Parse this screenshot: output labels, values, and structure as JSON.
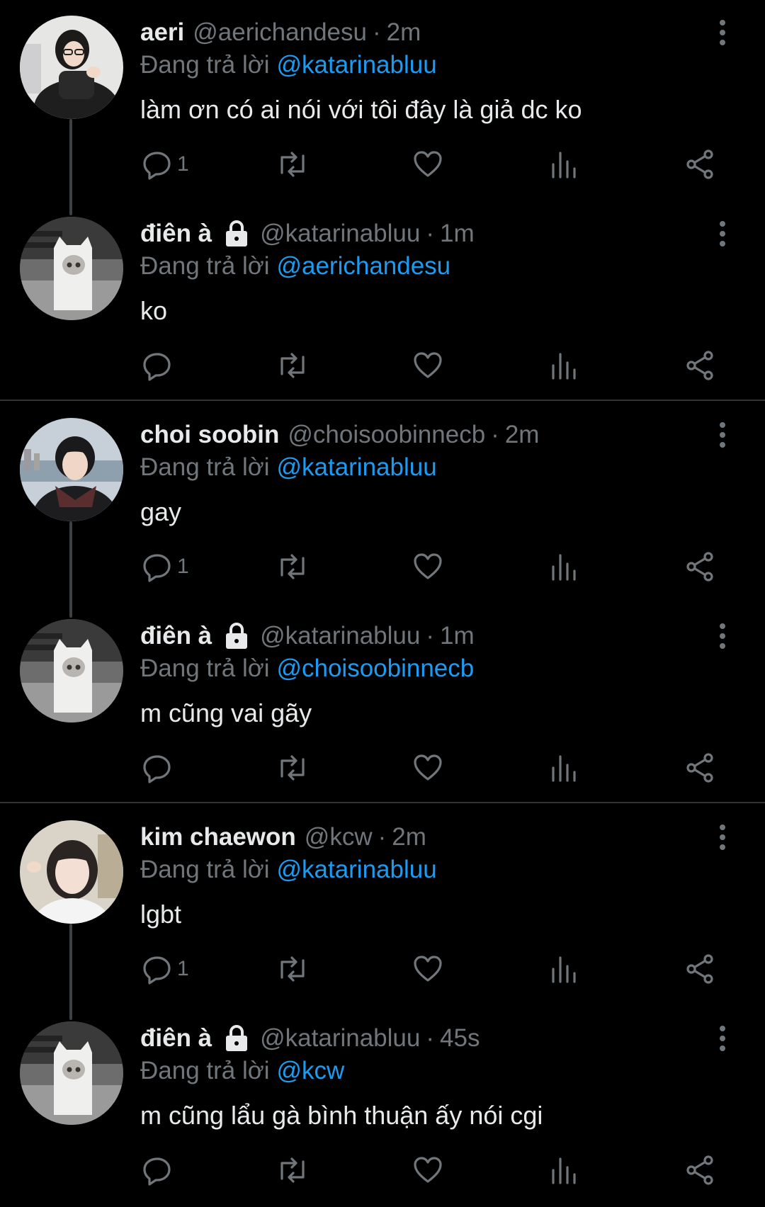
{
  "colors": {
    "background": "#000000",
    "primary_text": "#e7e9ea",
    "secondary_text": "#71767b",
    "mention_blue": "#1d9bf0",
    "divider": "#2f3336"
  },
  "threads": [
    {
      "tweets": [
        {
          "name": "aeri",
          "locked": false,
          "handle": "@aerichandesu",
          "separator": "·",
          "time": "2m",
          "reply_label": "Đang trả lời",
          "reply_to": "@katarinabluu",
          "text": "làm ơn có ai nói với tôi đây là giả dc ko",
          "reply_count": "1",
          "avatar": "aeri-avatar"
        },
        {
          "name": "điên à",
          "locked": true,
          "handle": "@katarinabluu",
          "separator": "·",
          "time": "1m",
          "reply_label": "Đang trả lời",
          "reply_to": "@aerichandesu",
          "text": "ko",
          "reply_count": "",
          "avatar": "ghost-figure-avatar"
        }
      ]
    },
    {
      "tweets": [
        {
          "name": "choi soobin",
          "locked": false,
          "handle": "@choisoobinnecb",
          "separator": "·",
          "time": "2m",
          "reply_label": "Đang trả lời",
          "reply_to": "@katarinabluu",
          "text": "gay",
          "reply_count": "1",
          "avatar": "soobin-avatar"
        },
        {
          "name": "điên à",
          "locked": true,
          "handle": "@katarinabluu",
          "separator": "·",
          "time": "1m",
          "reply_label": "Đang trả lời",
          "reply_to": "@choisoobinnecb",
          "text": "m cũng vai gãy",
          "reply_count": "",
          "avatar": "ghost-figure-avatar"
        }
      ]
    },
    {
      "tweets": [
        {
          "name": "kim chaewon",
          "locked": false,
          "handle": "@kcw",
          "separator": "·",
          "time": "2m",
          "reply_label": "Đang trả lời",
          "reply_to": "@katarinabluu",
          "text": "lgbt",
          "reply_count": "1",
          "avatar": "chaewon-avatar"
        },
        {
          "name": "điên à",
          "locked": true,
          "handle": "@katarinabluu",
          "separator": "·",
          "time": "45s",
          "reply_label": "Đang trả lời",
          "reply_to": "@kcw",
          "text": "m cũng lẩu gà bình thuận ấy nói cgi",
          "reply_count": "",
          "avatar": "ghost-figure-avatar"
        }
      ]
    }
  ],
  "icons": {
    "reply": "reply-icon",
    "retweet": "retweet-icon",
    "like": "heart-icon",
    "views": "views-icon",
    "share": "share-icon",
    "more": "more-vertical-icon",
    "lock": "lock-icon"
  }
}
